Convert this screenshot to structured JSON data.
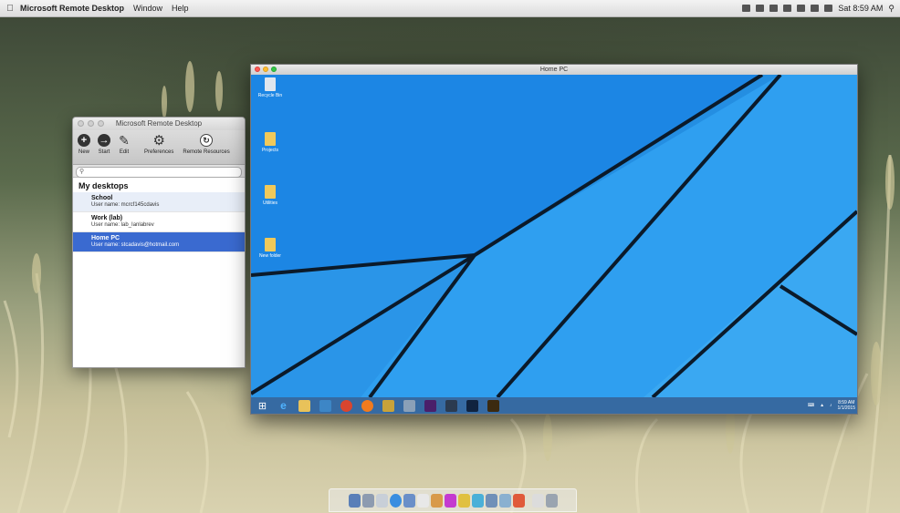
{
  "menubar": {
    "apple_icon": "apple-icon",
    "items": [
      "Microsoft Remote Desktop",
      "Window",
      "Help"
    ],
    "clock": "Sat 8:59 AM"
  },
  "rd_window": {
    "title": "Microsoft Remote Desktop",
    "toolbar": [
      {
        "label": "New",
        "icon": "plus-circle-icon"
      },
      {
        "label": "Start",
        "icon": "arrow-right-circle-icon"
      },
      {
        "label": "Edit",
        "icon": "pencil-icon"
      },
      {
        "label": "Preferences",
        "icon": "gear-icon"
      },
      {
        "label": "Remote Resources",
        "icon": "remote-resources-icon"
      }
    ],
    "section_title": "My desktops",
    "desktops": [
      {
        "name": "School",
        "user": "User name: mcrcf145cdavis"
      },
      {
        "name": "Work (lab)",
        "user": "User name: lab_Ianlabrev"
      },
      {
        "name": "Home PC",
        "user": "User name: stcadavis@hotmail.com"
      }
    ],
    "selected_index": 2
  },
  "home_window": {
    "title": "Home PC",
    "desktop_icons": [
      "Recycle Bin",
      "Projects",
      "Utilities",
      "New folder"
    ],
    "tray_time": "8:59 AM",
    "tray_date": "1/1/2015"
  },
  "colors": {
    "desktop_blue": "#1a8fe0",
    "selection_blue": "#3a6ad0"
  }
}
